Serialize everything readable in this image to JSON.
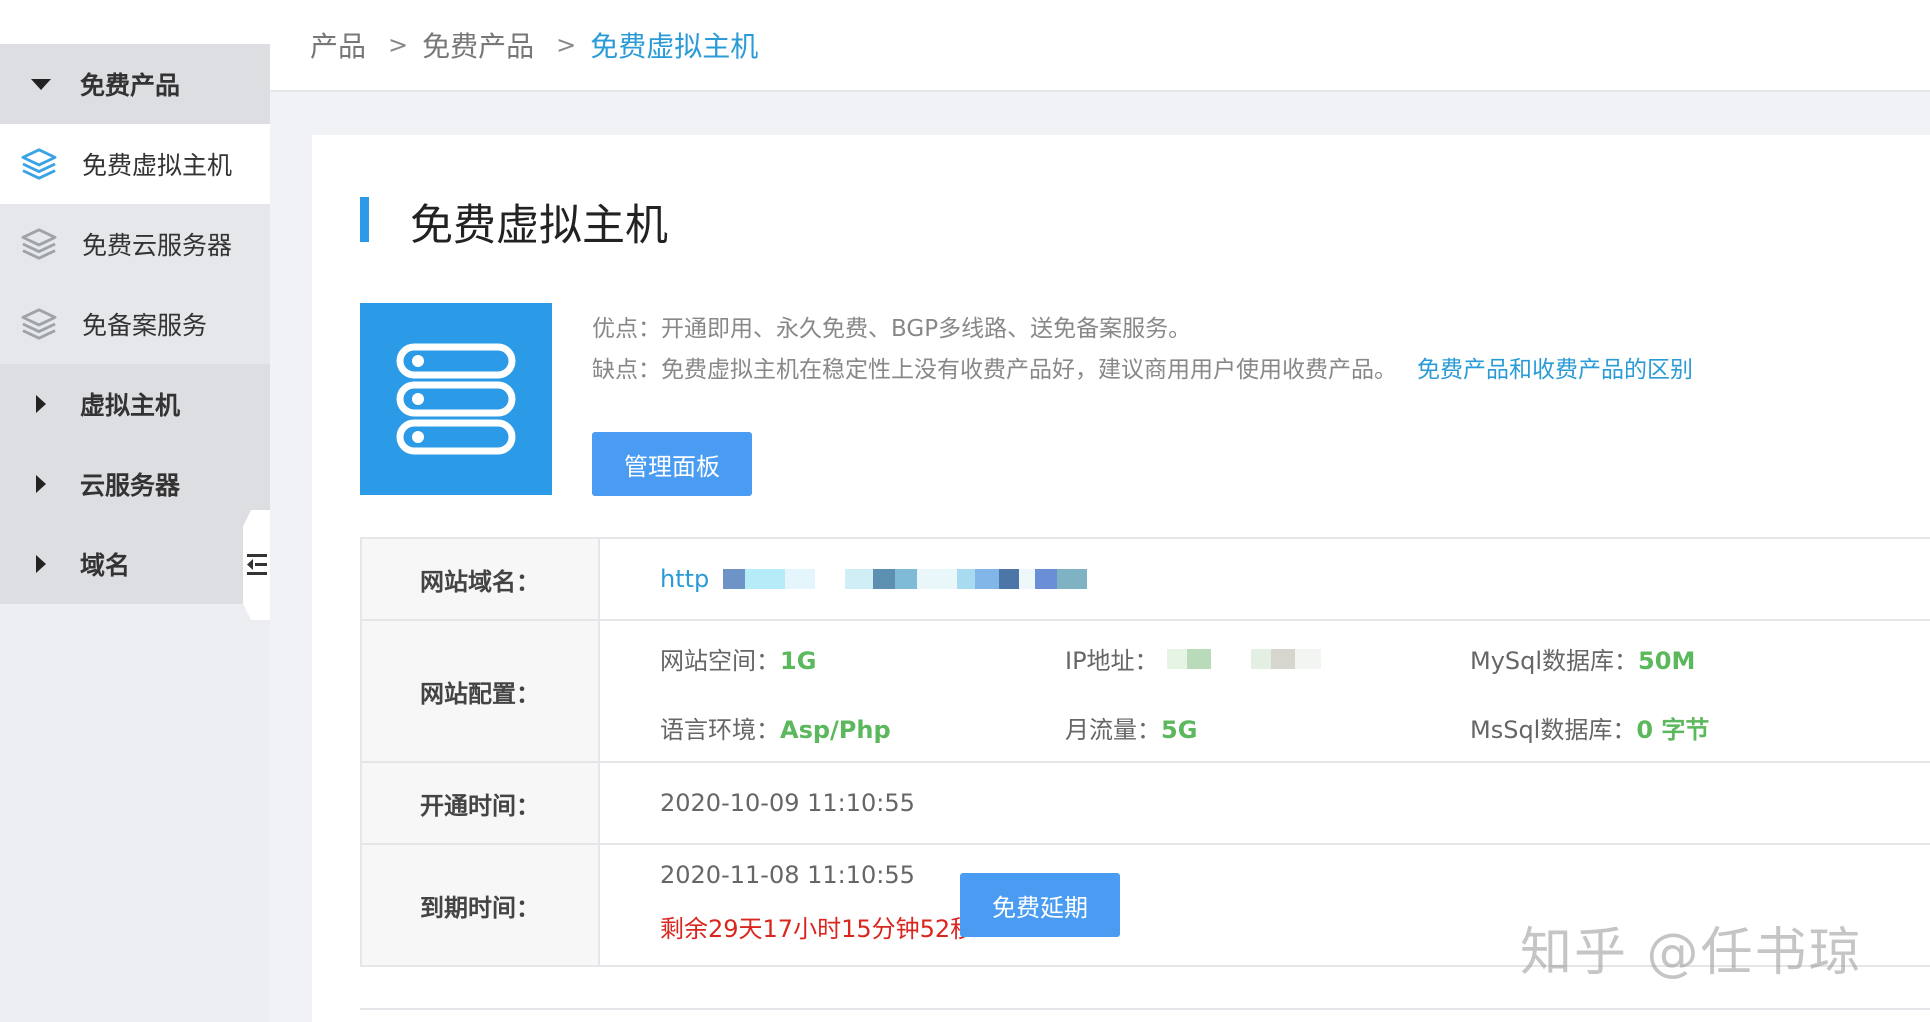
{
  "breadcrumb": {
    "items": [
      "产品",
      "免费产品"
    ],
    "current": "免费虚拟主机",
    "separator": ">"
  },
  "sidebar": {
    "groups": [
      {
        "label": "免费产品",
        "expanded": true
      },
      {
        "label": "虚拟主机",
        "expanded": false
      },
      {
        "label": "云服务器",
        "expanded": false
      },
      {
        "label": "域名",
        "expanded": false
      }
    ],
    "sub_items": [
      {
        "label": "免费虚拟主机",
        "active": true
      },
      {
        "label": "免费云服务器",
        "active": false
      },
      {
        "label": "免备案服务",
        "active": false
      }
    ]
  },
  "page": {
    "title": "免费虚拟主机",
    "pros": "优点：开通即用、永久免费、BGP多线路、送免备案服务。",
    "cons": "缺点：免费虚拟主机在稳定性上没有收费产品好，建议商用用户使用收费产品。",
    "compare_link": "免费产品和收费产品的区别",
    "manage_button": "管理面板"
  },
  "table": {
    "domain_label": "网站域名：",
    "domain_value": "http",
    "config_label": "网站配置：",
    "config": {
      "space_key": "网站空间：",
      "space_val": "1G",
      "ip_key": "IP地址：",
      "mysql_key": "MySql数据库：",
      "mysql_val": "50M",
      "lang_key": "语言环境：",
      "lang_val": "Asp/Php",
      "traffic_key": "月流量：",
      "traffic_val": "5G",
      "mssql_key": "MsSql数据库：",
      "mssql_val": "0 字节"
    },
    "open_label": "开通时间：",
    "open_value": "2020-10-09 11:10:55",
    "expire_label": "到期时间：",
    "expire_value": "2020-11-08 11:10:55",
    "remaining": "剩余29天17小时15分钟52秒",
    "extend_button": "免费延期"
  },
  "watermark": "知乎 @任书琼",
  "colors": {
    "accent": "#2b9be8",
    "button": "#4a9cf2",
    "green": "#5cb85c",
    "red": "#d9261f"
  }
}
